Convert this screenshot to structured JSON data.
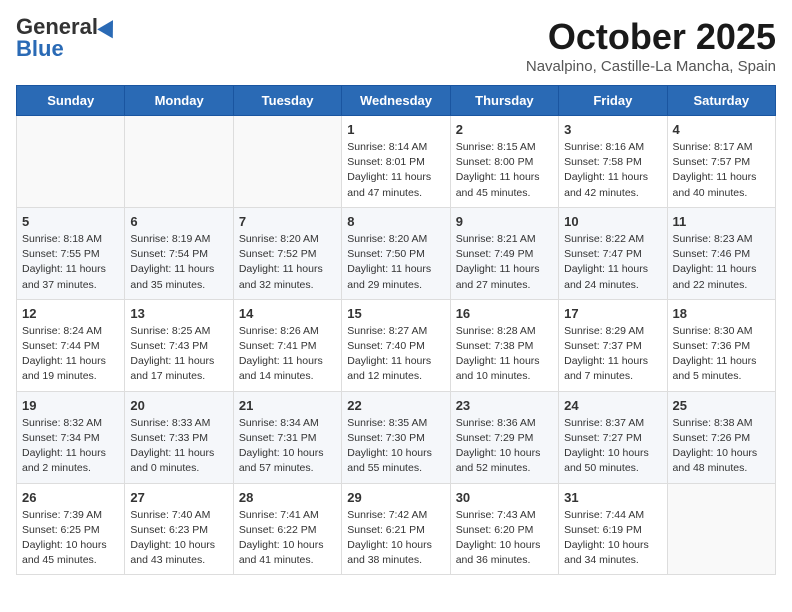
{
  "header": {
    "logo_general": "General",
    "logo_blue": "Blue",
    "month": "October 2025",
    "location": "Navalpino, Castille-La Mancha, Spain"
  },
  "weekdays": [
    "Sunday",
    "Monday",
    "Tuesday",
    "Wednesday",
    "Thursday",
    "Friday",
    "Saturday"
  ],
  "weeks": [
    [
      {
        "day": "",
        "info": ""
      },
      {
        "day": "",
        "info": ""
      },
      {
        "day": "",
        "info": ""
      },
      {
        "day": "1",
        "info": "Sunrise: 8:14 AM\nSunset: 8:01 PM\nDaylight: 11 hours\nand 47 minutes."
      },
      {
        "day": "2",
        "info": "Sunrise: 8:15 AM\nSunset: 8:00 PM\nDaylight: 11 hours\nand 45 minutes."
      },
      {
        "day": "3",
        "info": "Sunrise: 8:16 AM\nSunset: 7:58 PM\nDaylight: 11 hours\nand 42 minutes."
      },
      {
        "day": "4",
        "info": "Sunrise: 8:17 AM\nSunset: 7:57 PM\nDaylight: 11 hours\nand 40 minutes."
      }
    ],
    [
      {
        "day": "5",
        "info": "Sunrise: 8:18 AM\nSunset: 7:55 PM\nDaylight: 11 hours\nand 37 minutes."
      },
      {
        "day": "6",
        "info": "Sunrise: 8:19 AM\nSunset: 7:54 PM\nDaylight: 11 hours\nand 35 minutes."
      },
      {
        "day": "7",
        "info": "Sunrise: 8:20 AM\nSunset: 7:52 PM\nDaylight: 11 hours\nand 32 minutes."
      },
      {
        "day": "8",
        "info": "Sunrise: 8:20 AM\nSunset: 7:50 PM\nDaylight: 11 hours\nand 29 minutes."
      },
      {
        "day": "9",
        "info": "Sunrise: 8:21 AM\nSunset: 7:49 PM\nDaylight: 11 hours\nand 27 minutes."
      },
      {
        "day": "10",
        "info": "Sunrise: 8:22 AM\nSunset: 7:47 PM\nDaylight: 11 hours\nand 24 minutes."
      },
      {
        "day": "11",
        "info": "Sunrise: 8:23 AM\nSunset: 7:46 PM\nDaylight: 11 hours\nand 22 minutes."
      }
    ],
    [
      {
        "day": "12",
        "info": "Sunrise: 8:24 AM\nSunset: 7:44 PM\nDaylight: 11 hours\nand 19 minutes."
      },
      {
        "day": "13",
        "info": "Sunrise: 8:25 AM\nSunset: 7:43 PM\nDaylight: 11 hours\nand 17 minutes."
      },
      {
        "day": "14",
        "info": "Sunrise: 8:26 AM\nSunset: 7:41 PM\nDaylight: 11 hours\nand 14 minutes."
      },
      {
        "day": "15",
        "info": "Sunrise: 8:27 AM\nSunset: 7:40 PM\nDaylight: 11 hours\nand 12 minutes."
      },
      {
        "day": "16",
        "info": "Sunrise: 8:28 AM\nSunset: 7:38 PM\nDaylight: 11 hours\nand 10 minutes."
      },
      {
        "day": "17",
        "info": "Sunrise: 8:29 AM\nSunset: 7:37 PM\nDaylight: 11 hours\nand 7 minutes."
      },
      {
        "day": "18",
        "info": "Sunrise: 8:30 AM\nSunset: 7:36 PM\nDaylight: 11 hours\nand 5 minutes."
      }
    ],
    [
      {
        "day": "19",
        "info": "Sunrise: 8:32 AM\nSunset: 7:34 PM\nDaylight: 11 hours\nand 2 minutes."
      },
      {
        "day": "20",
        "info": "Sunrise: 8:33 AM\nSunset: 7:33 PM\nDaylight: 11 hours\nand 0 minutes."
      },
      {
        "day": "21",
        "info": "Sunrise: 8:34 AM\nSunset: 7:31 PM\nDaylight: 10 hours\nand 57 minutes."
      },
      {
        "day": "22",
        "info": "Sunrise: 8:35 AM\nSunset: 7:30 PM\nDaylight: 10 hours\nand 55 minutes."
      },
      {
        "day": "23",
        "info": "Sunrise: 8:36 AM\nSunset: 7:29 PM\nDaylight: 10 hours\nand 52 minutes."
      },
      {
        "day": "24",
        "info": "Sunrise: 8:37 AM\nSunset: 7:27 PM\nDaylight: 10 hours\nand 50 minutes."
      },
      {
        "day": "25",
        "info": "Sunrise: 8:38 AM\nSunset: 7:26 PM\nDaylight: 10 hours\nand 48 minutes."
      }
    ],
    [
      {
        "day": "26",
        "info": "Sunrise: 7:39 AM\nSunset: 6:25 PM\nDaylight: 10 hours\nand 45 minutes."
      },
      {
        "day": "27",
        "info": "Sunrise: 7:40 AM\nSunset: 6:23 PM\nDaylight: 10 hours\nand 43 minutes."
      },
      {
        "day": "28",
        "info": "Sunrise: 7:41 AM\nSunset: 6:22 PM\nDaylight: 10 hours\nand 41 minutes."
      },
      {
        "day": "29",
        "info": "Sunrise: 7:42 AM\nSunset: 6:21 PM\nDaylight: 10 hours\nand 38 minutes."
      },
      {
        "day": "30",
        "info": "Sunrise: 7:43 AM\nSunset: 6:20 PM\nDaylight: 10 hours\nand 36 minutes."
      },
      {
        "day": "31",
        "info": "Sunrise: 7:44 AM\nSunset: 6:19 PM\nDaylight: 10 hours\nand 34 minutes."
      },
      {
        "day": "",
        "info": ""
      }
    ]
  ]
}
